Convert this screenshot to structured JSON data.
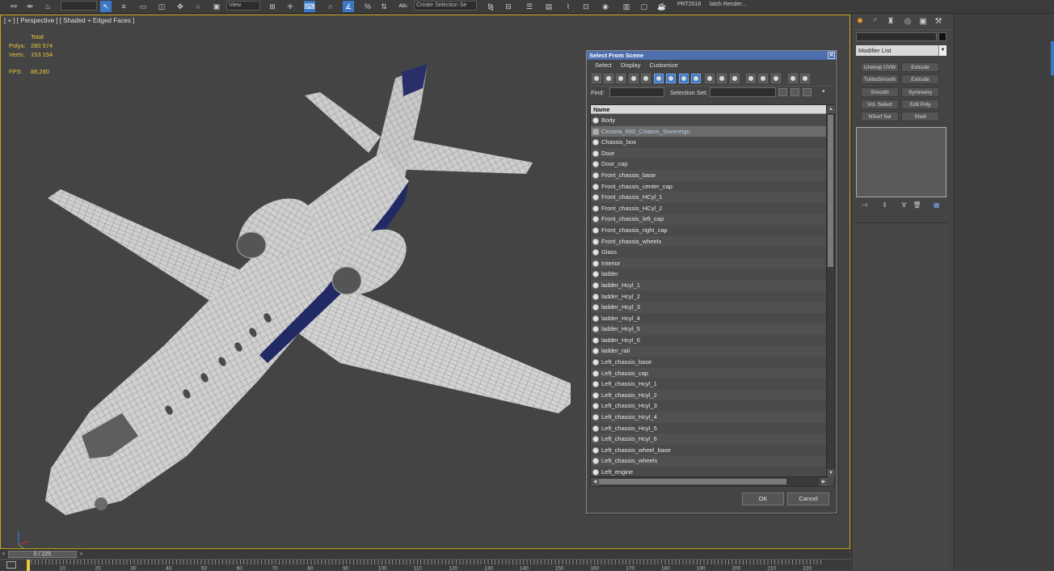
{
  "toolbar": {
    "render_setup_text": "PRT2016",
    "batch_render_text": "latch Render...",
    "selection_set_combo": "Create Selection Se",
    "view_combo": "View"
  },
  "viewport": {
    "label": "[ + ] [ Perspective ] [ Shaded + Edged Faces ]",
    "stats": {
      "total_label": "Total",
      "polys_label": "Polys:",
      "polys_value": "290 574",
      "verts_label": "Verts:",
      "verts_value": "153 154",
      "fps_label": "FPS:",
      "fps_value": "88,280"
    },
    "border_color": "#c9a21b"
  },
  "dialog": {
    "title": "Select From Scene",
    "close_glyph": "✕",
    "menu": [
      "Select",
      "Display",
      "Customize"
    ],
    "find_label": "Find:",
    "find_value": "",
    "selection_set_label": "Selection Set:",
    "column_header": "Name",
    "objects": [
      "Body",
      "Cessna_680_Citation_Sovereign",
      "Chassis_box",
      "Door",
      "Door_cap",
      "Front_chassis_base",
      "Front_chassis_center_cap",
      "Front_chassis_HCyl_1",
      "Front_chassis_HCyl_2",
      "Front_chassis_left_cap",
      "Front_chassis_right_cap",
      "Front_chassis_wheels",
      "Glass",
      "Interior",
      "ladder",
      "ladder_Hcyl_1",
      "ladder_Hcyl_2",
      "ladder_Hcyl_3",
      "ladder_Hcyl_4",
      "ladder_Hcyl_5",
      "ladder_Hcyl_6",
      "ladder_rail",
      "Left_chassis_base",
      "Left_chassis_cap",
      "Left_chassis_Hcyl_1",
      "Left_chassis_Hcyl_2",
      "Left_chassis_Hcyl_3",
      "Left_chassis_Hcyl_4",
      "Left_chassis_Hcyl_5",
      "Left_chassis_Hcyl_6",
      "Left_chassis_wheel_base",
      "Left_chassis_wheels",
      "Left_engine"
    ],
    "selected_index": 1,
    "ok_label": "OK",
    "cancel_label": "Cancel",
    "title_color": "#4d6fae"
  },
  "command_panel": {
    "modifier_list": "Modifier List",
    "buttons": [
      [
        "Unwrap UVW",
        "Extrude"
      ],
      [
        "TurboSmooth",
        "Extrude"
      ],
      [
        "Smooth",
        "Symmetry"
      ],
      [
        "Vol. Select",
        "Edit Poly"
      ],
      [
        "NSurf Sel",
        "Shell"
      ]
    ]
  },
  "timeline": {
    "frame_readout": "0 / 225",
    "prev_glyph": "<",
    "next_glyph": ">",
    "ruler_labels": [
      "10",
      "20",
      "30",
      "40",
      "50",
      "60",
      "70",
      "80",
      "90",
      "100",
      "110",
      "120",
      "130",
      "140",
      "150",
      "160",
      "170",
      "180",
      "190",
      "200",
      "210",
      "220"
    ]
  }
}
